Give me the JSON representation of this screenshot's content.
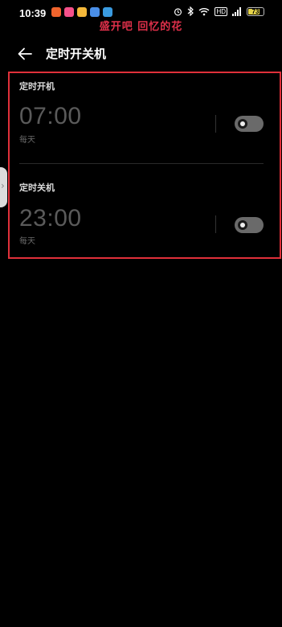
{
  "status_bar": {
    "time": "10:39",
    "battery": "73",
    "hd_label": "HD",
    "app_icon_colors": [
      "#f0642d",
      "#f5508a",
      "#f5b83a",
      "#4a8fe8",
      "#3a9be0"
    ]
  },
  "overlay_text": "盛开吧 回忆的花",
  "header": {
    "title": "定时开关机",
    "back_icon": "arrow-left-icon"
  },
  "schedules": [
    {
      "title": "定时开机",
      "time": "07:00",
      "repeat": "每天",
      "enabled": false
    },
    {
      "title": "定时关机",
      "time": "23:00",
      "repeat": "每天",
      "enabled": false
    }
  ],
  "colors": {
    "highlight": "#e0303a",
    "overlay_text": "#e0304a",
    "background": "#000000"
  }
}
